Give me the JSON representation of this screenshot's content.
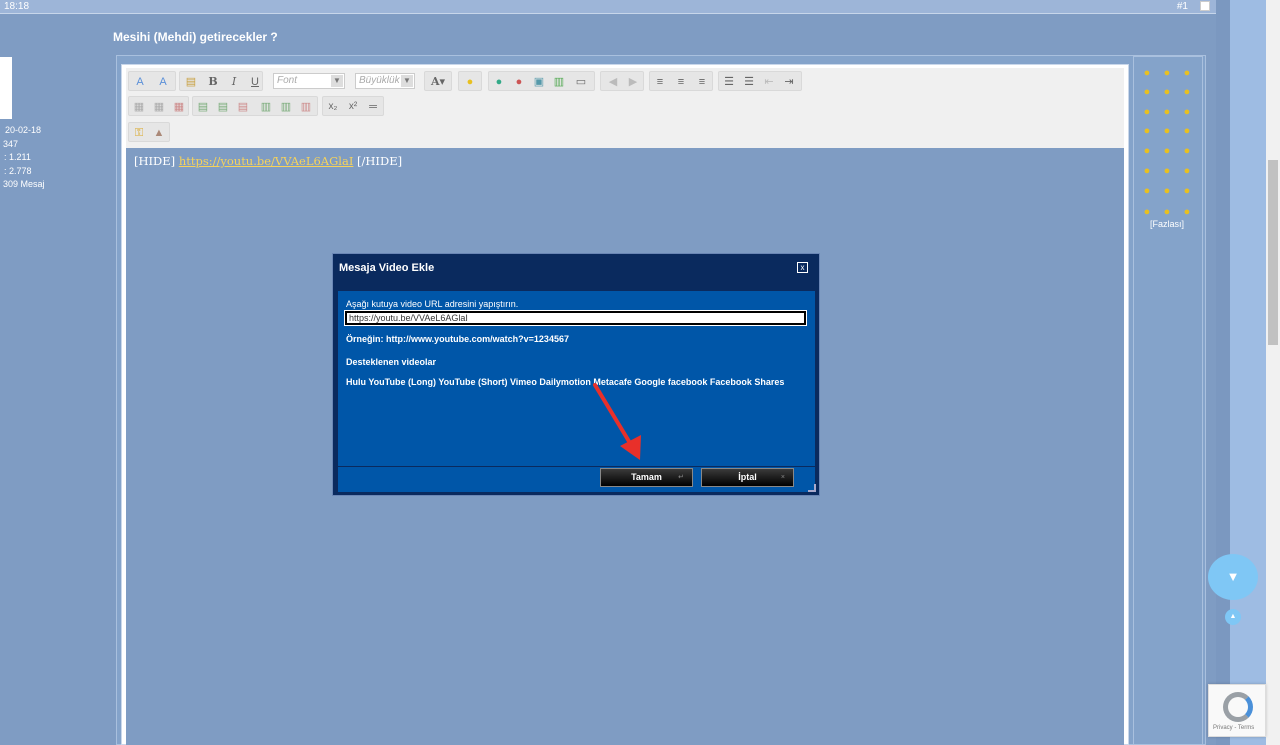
{
  "topbar": {
    "time": "18:18",
    "post_number": "#1"
  },
  "user": {
    "joined": "20-02-18",
    "stat1": "347",
    "stat2": ":   1.211",
    "stat3": ":   2.778",
    "messages": "309 Mesaj"
  },
  "thread_title": "Mesihi (Mehdi) getirecekler ?",
  "toolbar": {
    "font_placeholder": "Font",
    "size_placeholder": "Büyüklük",
    "color_label": "A"
  },
  "editor_content": {
    "prefix": "[HIDE] ",
    "link": "https://youtu.be/VVAeL6AGlaI",
    "suffix": " [/HIDE]"
  },
  "smileys": {
    "more_label": "[Fazlası]"
  },
  "dialog": {
    "title": "Mesaja Video Ekle",
    "close": "x",
    "instruction": "Aşağı kutuya video URL adresini yapıştırın.",
    "url_value": "https://youtu.be/VVAeL6AGlaI",
    "example": "Örneğin: http://www.youtube.com/watch?v=1234567",
    "supported_heading": "Desteklenen videolar",
    "supported_list": "Hulu YouTube (Long) YouTube (Short) Vimeo Dailymotion Metacafe Google facebook Facebook Shares",
    "ok_button": "Tamam",
    "cancel_button": "İptal"
  },
  "scroll_controls": {
    "down": "▼",
    "up": "▲"
  },
  "recaptcha": {
    "text": "Privacy - Terms"
  },
  "colors": {
    "annotation_arrow": "#e8302a",
    "dialog_bg": "#0056a8",
    "link": "#f7d35a"
  }
}
